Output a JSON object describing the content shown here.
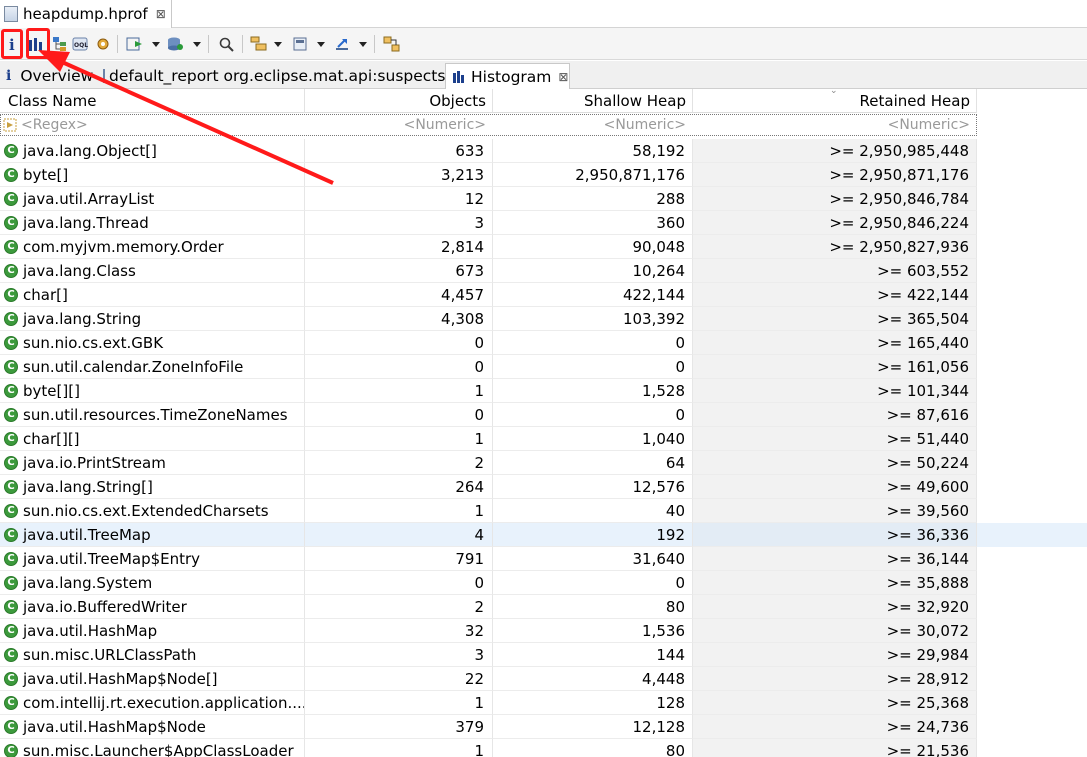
{
  "editor_tab": {
    "title": "heapdump.hprof",
    "close": "⊠"
  },
  "inner_tabs": [
    {
      "label": "Overview",
      "icon": "info-icon"
    },
    {
      "label": "default_report  org.eclipse.mat.api:suspects",
      "icon": "report-icon"
    },
    {
      "label": "Histogram",
      "icon": "histogram-icon",
      "close": "⊠"
    }
  ],
  "columns": {
    "class_name": "Class Name",
    "objects": "Objects",
    "shallow_heap": "Shallow Heap",
    "retained_heap": "Retained Heap"
  },
  "filters": {
    "class_name": "<Regex>",
    "objects": "<Numeric>",
    "shallow_heap": "<Numeric>",
    "retained_heap": "<Numeric>"
  },
  "rows": [
    {
      "name": "java.lang.Object[]",
      "objects": "633",
      "shallow": "58,192",
      "retained": ">= 2,950,985,448"
    },
    {
      "name": "byte[]",
      "objects": "3,213",
      "shallow": "2,950,871,176",
      "retained": ">= 2,950,871,176"
    },
    {
      "name": "java.util.ArrayList",
      "objects": "12",
      "shallow": "288",
      "retained": ">= 2,950,846,784"
    },
    {
      "name": "java.lang.Thread",
      "objects": "3",
      "shallow": "360",
      "retained": ">= 2,950,846,224"
    },
    {
      "name": "com.myjvm.memory.Order",
      "objects": "2,814",
      "shallow": "90,048",
      "retained": ">= 2,950,827,936"
    },
    {
      "name": "java.lang.Class",
      "objects": "673",
      "shallow": "10,264",
      "retained": ">= 603,552"
    },
    {
      "name": "char[]",
      "objects": "4,457",
      "shallow": "422,144",
      "retained": ">= 422,144"
    },
    {
      "name": "java.lang.String",
      "objects": "4,308",
      "shallow": "103,392",
      "retained": ">= 365,504"
    },
    {
      "name": "sun.nio.cs.ext.GBK",
      "objects": "0",
      "shallow": "0",
      "retained": ">= 165,440"
    },
    {
      "name": "sun.util.calendar.ZoneInfoFile",
      "objects": "0",
      "shallow": "0",
      "retained": ">= 161,056"
    },
    {
      "name": "byte[][]",
      "objects": "1",
      "shallow": "1,528",
      "retained": ">= 101,344"
    },
    {
      "name": "sun.util.resources.TimeZoneNames",
      "objects": "0",
      "shallow": "0",
      "retained": ">= 87,616"
    },
    {
      "name": "char[][]",
      "objects": "1",
      "shallow": "1,040",
      "retained": ">= 51,440"
    },
    {
      "name": "java.io.PrintStream",
      "objects": "2",
      "shallow": "64",
      "retained": ">= 50,224"
    },
    {
      "name": "java.lang.String[]",
      "objects": "264",
      "shallow": "12,576",
      "retained": ">= 49,600"
    },
    {
      "name": "sun.nio.cs.ext.ExtendedCharsets",
      "objects": "1",
      "shallow": "40",
      "retained": ">= 39,560"
    },
    {
      "name": "java.util.TreeMap",
      "objects": "4",
      "shallow": "192",
      "retained": ">= 36,336",
      "selected": true
    },
    {
      "name": "java.util.TreeMap$Entry",
      "objects": "791",
      "shallow": "31,640",
      "retained": ">= 36,144"
    },
    {
      "name": "java.lang.System",
      "objects": "0",
      "shallow": "0",
      "retained": ">= 35,888"
    },
    {
      "name": "java.io.BufferedWriter",
      "objects": "2",
      "shallow": "80",
      "retained": ">= 32,920"
    },
    {
      "name": "java.util.HashMap",
      "objects": "32",
      "shallow": "1,536",
      "retained": ">= 30,072"
    },
    {
      "name": "sun.misc.URLClassPath",
      "objects": "3",
      "shallow": "144",
      "retained": ">= 29,984"
    },
    {
      "name": "java.util.HashMap$Node[]",
      "objects": "22",
      "shallow": "4,448",
      "retained": ">= 28,912"
    },
    {
      "name": "com.intellij.rt.execution.application....",
      "objects": "1",
      "shallow": "128",
      "retained": ">= 25,368"
    },
    {
      "name": "java.util.HashMap$Node",
      "objects": "379",
      "shallow": "12,128",
      "retained": ">= 24,736"
    },
    {
      "name": "sun.misc.Launcher$AppClassLoader",
      "objects": "1",
      "shallow": "80",
      "retained": ">= 21,536"
    }
  ],
  "class_icon_letter": "C",
  "accent_color": "#ff1a1a",
  "class_icon_color": "#3c9a3c"
}
